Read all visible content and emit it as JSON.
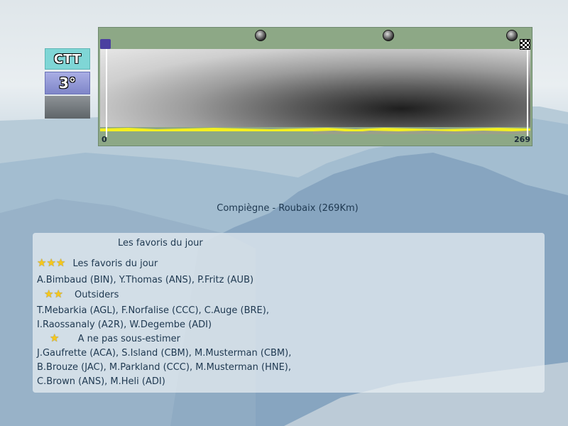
{
  "badges": {
    "type": "CTT",
    "category": "3°",
    "weather_icon": "cloudy-sky-icon"
  },
  "profile": {
    "start_km": "0",
    "end_km": "269",
    "checkpoints": [
      "cobble-sector-icon",
      "cobble-sector-icon",
      "cobble-sector-icon"
    ],
    "start_icon": "start-flag-icon",
    "finish_icon": "checkered-flag-icon"
  },
  "race": {
    "title": "Compiègne - Roubaix (269Km)"
  },
  "favorites": {
    "header": "Les favoris du jour",
    "sections": [
      {
        "stars": "★★★",
        "title": "Les favoris du jour",
        "lines": [
          "A.Bimbaud (BIN), Y.Thomas (ANS), P.Fritz (AUB)"
        ]
      },
      {
        "stars": "★★",
        "title": "Outsiders",
        "lines": [
          "T.Mebarkia (AGL), F.Norfalise (CCC), C.Auge (BRE),",
          "I.Raossanaly (A2R), W.Degembe (ADI)"
        ]
      },
      {
        "stars": "★",
        "title": "A ne pas sous-estimer",
        "lines": [
          "J.Gaufrette (ACA), S.Island (CBM), M.Musterman (CBM),",
          "B.Brouze (JAC), M.Parkland (CCC), M.Musterman (HNE),",
          "C.Brown (ANS), M.Heli (ADI)"
        ]
      }
    ]
  }
}
